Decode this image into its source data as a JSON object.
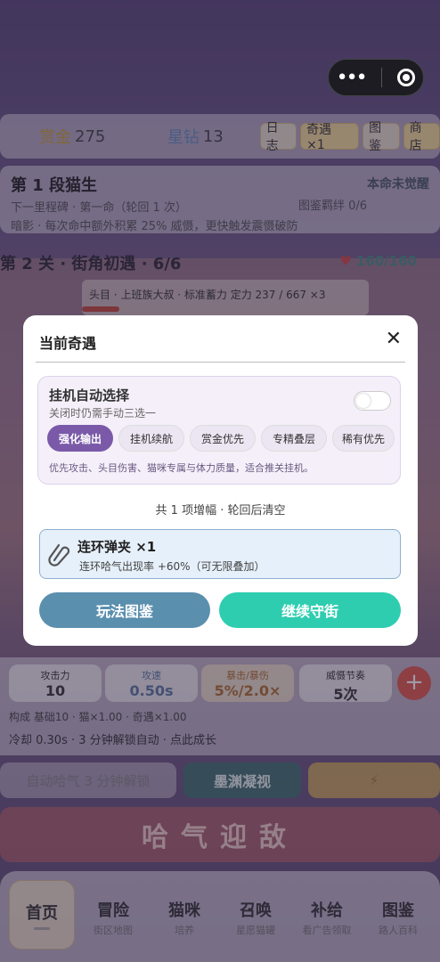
{
  "topbar": {
    "gold_label": "赏金",
    "gold_value": "275",
    "diamond_label": "星钻",
    "diamond_value": "13",
    "btn_log": "日志",
    "btn_encounter": "奇遇 ×1",
    "btn_codex": "图鉴",
    "btn_shop": "商店"
  },
  "player": {
    "title": "第 1 段猫生",
    "awake": "本命未觉醒",
    "line2": "下一里程碑 · 第一命（轮回 1 次）",
    "bond": "图鉴羁绊 0/6",
    "line3": "暗影 · 每次命中额外积累 25% 威慑，更快触发震慑破防"
  },
  "stage": {
    "title": "第 2 关 · 街角初遇 · 6/6",
    "hp": "160/160",
    "hp_icon": "lungs-icon"
  },
  "boss": {
    "text": "头目 · 上班族大叔 · 标准蓄力 定力 237 / 667 ×3",
    "progress": 0.36
  },
  "stats": {
    "atk_label": "攻击力",
    "atk_value": "10",
    "spd_label": "攻速",
    "spd_value": "0.50s",
    "crit_label": "暴击/暴伤",
    "crit_value": "5%/2.0×",
    "rhythm_label": "威慑节奏",
    "rhythm_value": "5次",
    "plus": "+",
    "formula": "构成 基础10 · 猫×1.00 · 奇遇×1.00",
    "cooldown": "冷却 0.30s · 3 分钟解锁自动 · 点此成长"
  },
  "actions": {
    "auto_locked": "自动哈气 3 分钟解锁",
    "abyss": "墨渊凝视",
    "locked_right": "⚡"
  },
  "attack": "哈气迎敌",
  "nav": [
    {
      "a": "首页",
      "b": ""
    },
    {
      "a": "冒险",
      "b": "街区地图"
    },
    {
      "a": "猫咪",
      "b": "培养"
    },
    {
      "a": "召唤",
      "b": "星愿猫罐"
    },
    {
      "a": "补给",
      "b": "看广告领取"
    },
    {
      "a": "图鉴",
      "b": "路人百科"
    }
  ],
  "modal": {
    "title": "当前奇遇",
    "close": "✕",
    "auto_title": "挂机自动选择",
    "auto_sub": "关闭时仍需手动三选一",
    "options": [
      "强化输出",
      "挂机续航",
      "赏金优先",
      "专精叠层",
      "稀有优先"
    ],
    "selected_option": "强化输出",
    "auto_desc": "优先攻击、头目伤害、猫咪专属与体力质量，适合推关挂机。",
    "count": "共 1 项增幅 · 轮回后清空",
    "buff_name": "连环弹夹 ×1",
    "buff_desc": "连环哈气出现率 +60%（可无限叠加）",
    "btn_guide": "玩法图鉴",
    "btn_continue": "继续守街"
  },
  "colors": {
    "primary": "#2fcdb0",
    "secondary": "#5b8fae",
    "accent": "#7a5aa8"
  }
}
